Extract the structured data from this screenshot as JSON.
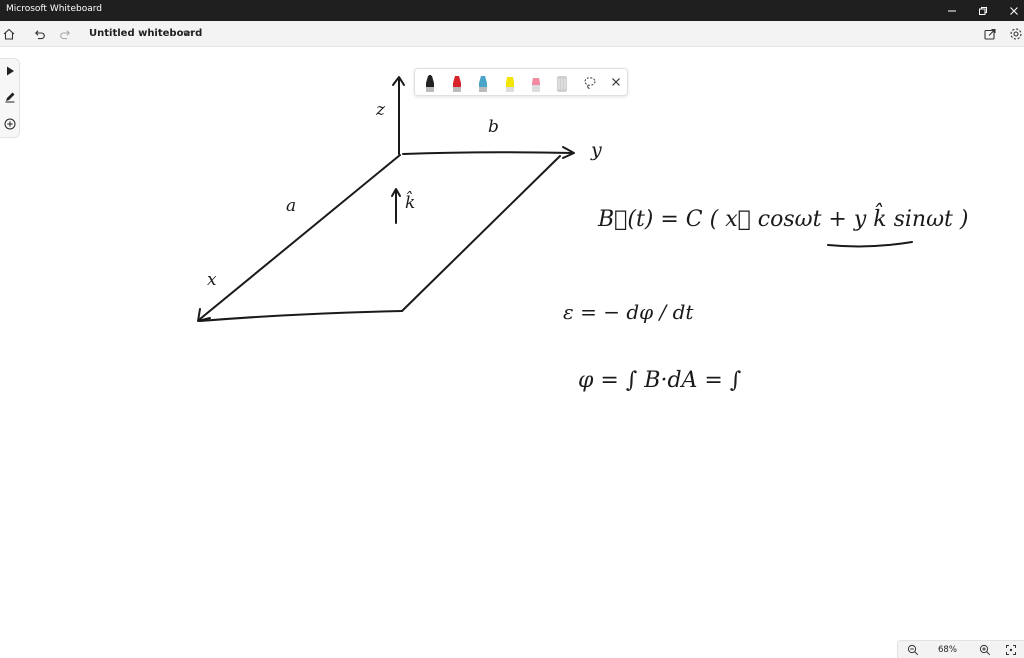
{
  "window": {
    "app_title": "Microsoft Whiteboard",
    "minimize_icon": "minimize-icon",
    "maximize_icon": "restore-icon",
    "close_icon": "close-icon"
  },
  "appbar": {
    "doc_title": "Untitled whiteboard",
    "icons": [
      "home-icon",
      "undo-icon",
      "redo-icon",
      "chevron-down-icon",
      "share-icon",
      "gear-icon"
    ]
  },
  "left_toolbar": [
    "select-arrow-icon",
    "ink-pen-icon",
    "add-icon"
  ],
  "pen_tray": {
    "pens": [
      {
        "name": "black",
        "color": "#222222"
      },
      {
        "name": "red",
        "color": "#d8232a"
      },
      {
        "name": "blue",
        "color": "#4aa3c8"
      },
      {
        "name": "yellow",
        "color": "#f2e600"
      },
      {
        "name": "pink",
        "color": "#f08aa0"
      },
      {
        "name": "ruler",
        "color": "#cfcfcf"
      }
    ],
    "lasso_icon": "lasso-icon",
    "close_icon": "close-icon"
  },
  "whiteboard": {
    "labels": {
      "z": "z",
      "b": "b",
      "y": "y",
      "a": "a",
      "x": "x",
      "k_hat": "k̂",
      "b_field": "B⃗(t) = C ( x⃗ cosωt + y k̂ sinωt )",
      "emf": "ε = − dφ / dt",
      "flux": "φ = ∫ B·dA = ∫"
    },
    "ink_color": "#1a1a1a"
  },
  "zoom": {
    "level": "68%"
  }
}
